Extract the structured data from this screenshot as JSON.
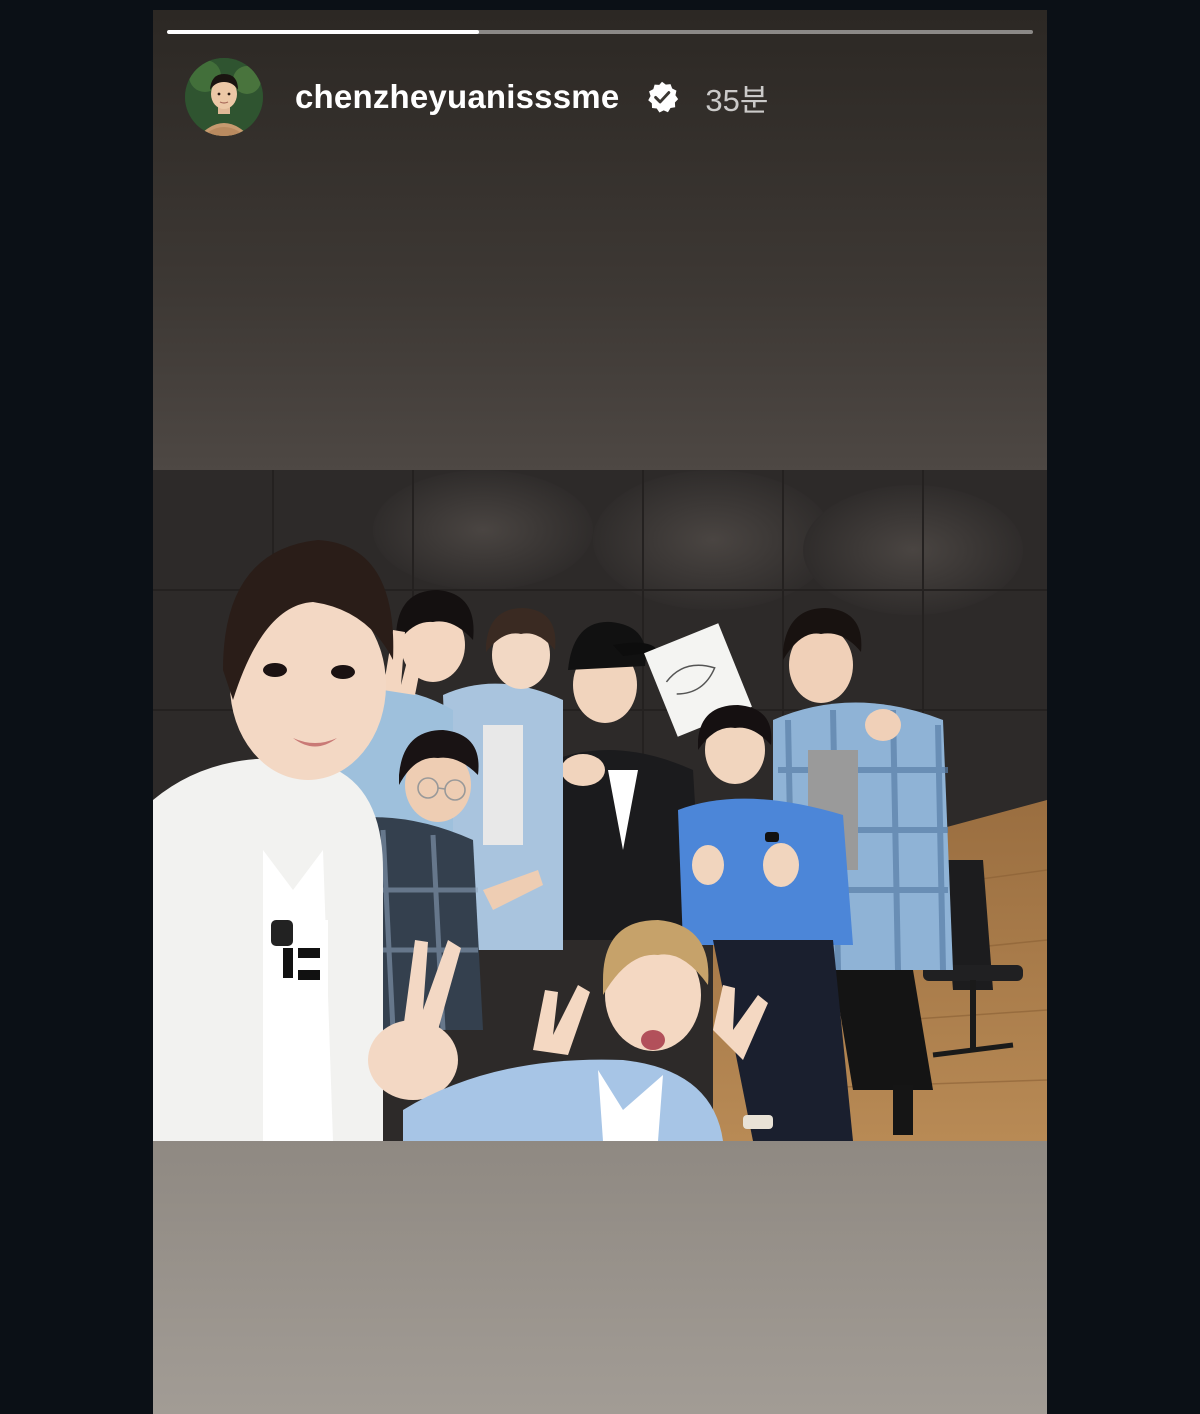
{
  "story": {
    "progress": 0.36,
    "username": "chenzheyuanisssme",
    "verified_icon": "verified-badge-icon",
    "time_ago": "35분"
  },
  "colors": {
    "viewer_bg": "#0b1016",
    "progress_track": "#8a8580",
    "progress_fill": "#ffffff",
    "username": "#ffffff",
    "time": "#bfbab5"
  }
}
